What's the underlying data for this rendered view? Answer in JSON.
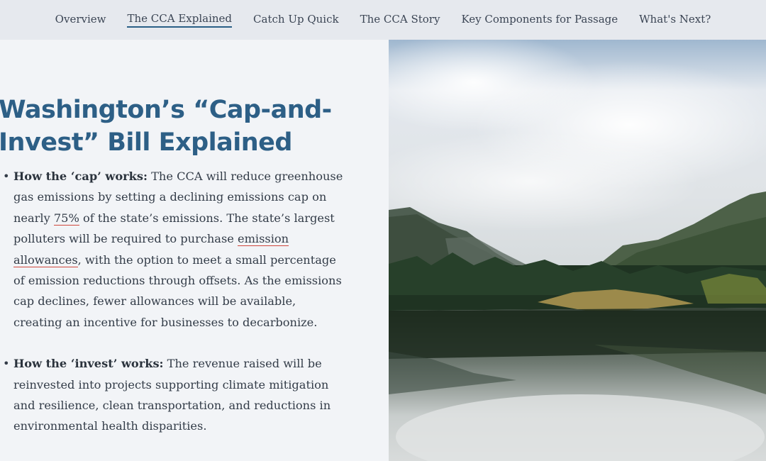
{
  "nav": {
    "items": [
      {
        "label": "Overview"
      },
      {
        "label": "The CCA Explained"
      },
      {
        "label": "Catch Up Quick"
      },
      {
        "label": "The CCA Story"
      },
      {
        "label": "Key Components for Passage"
      },
      {
        "label": "What's Next?"
      }
    ],
    "active_index": 1
  },
  "article": {
    "title": "Washington’s “Cap-and-Invest” Bill Explained",
    "cap": {
      "heading": "How the ‘cap’ works:",
      "text_1": " The CCA will reduce greenhouse gas emissions by setting a declining emissions cap on nearly ",
      "link_1": "75%",
      "text_2": " of the state’s emissions. The state’s largest polluters will be required to purchase ",
      "link_2": "emission allowances",
      "text_3": ", with the option to meet a small percentage of emission reductions through offsets. As the emissions cap declines, fewer allowances will be available, creating an incentive for businesses to decarbonize."
    },
    "invest": {
      "heading": "How the ‘invest’ works:",
      "text": " The revenue raised will be reinvested into projects supporting climate mitigation and resilience, clean transportation, and reductions in environmental health disparities."
    }
  },
  "colors": {
    "title": "#2d5f86",
    "active_underline": "#2a5f86",
    "link_underline": "#d0473c"
  }
}
